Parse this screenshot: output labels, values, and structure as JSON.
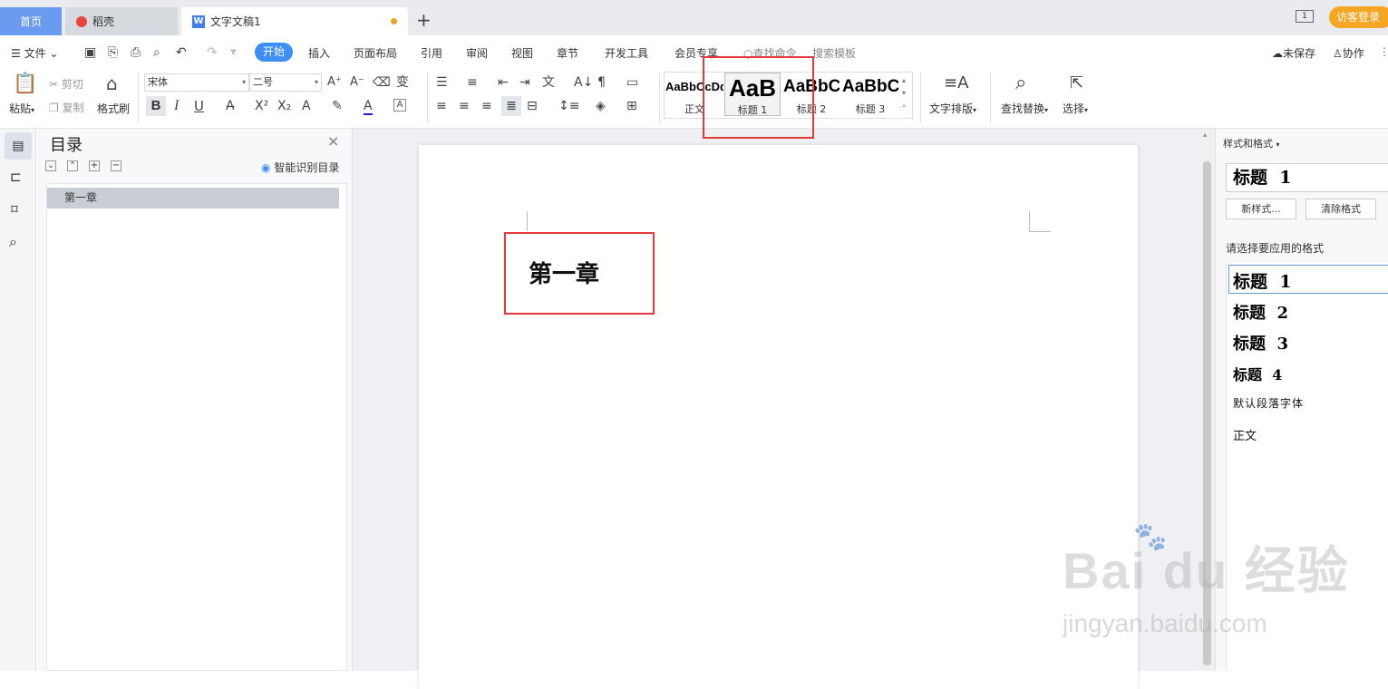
{
  "tabs": {
    "home": "首页",
    "shell": "稻壳",
    "doc": "文字文稿1",
    "add": "+",
    "login": "访客登录"
  },
  "menu": {
    "file": "文件",
    "items": [
      "开始",
      "插入",
      "页面布局",
      "引用",
      "审阅",
      "视图",
      "章节",
      "开发工具",
      "会员专享"
    ],
    "search_cmd": "查找命令",
    "search_tpl": "搜索模板",
    "unsaved": "未保存",
    "collab": "协作"
  },
  "ribbon": {
    "paste": "粘贴",
    "cut": "剪切",
    "copy": "复制",
    "format_painter": "格式刷",
    "font_name": "宋体",
    "font_size": "二号",
    "bold": "B",
    "italic": "I",
    "underline": "U",
    "styles": [
      {
        "preview": "AaBbCcDd",
        "label": "正文"
      },
      {
        "preview": "AaB",
        "label": "标题 1"
      },
      {
        "preview": "AaBbC",
        "label": "标题 2"
      },
      {
        "preview": "AaBbC",
        "label": "标题 3"
      }
    ],
    "text_layout": "文字排版",
    "find_replace": "查找替换",
    "select": "选择"
  },
  "nav": {
    "title": "目录",
    "smart_toc": "智能识别目录",
    "items": [
      "第一章"
    ]
  },
  "document": {
    "heading": "第一章"
  },
  "styles_panel": {
    "title": "样式和格式",
    "current": "标题  1",
    "new_style": "新样式...",
    "clear_format": "清除格式",
    "prompt": "请选择要应用的格式",
    "list": [
      "标题  1",
      "标题  2",
      "标题  3",
      "标题  4",
      "默认段落字体",
      "正文"
    ]
  },
  "watermark": {
    "brand": "Bai du 经验",
    "url": "jingyan.baidu.com"
  },
  "colors": {
    "accent": "#3e8ef7",
    "highlight_box": "#e8393a",
    "tab_home": "#6b9bef",
    "login_btn": "#f5a623"
  }
}
